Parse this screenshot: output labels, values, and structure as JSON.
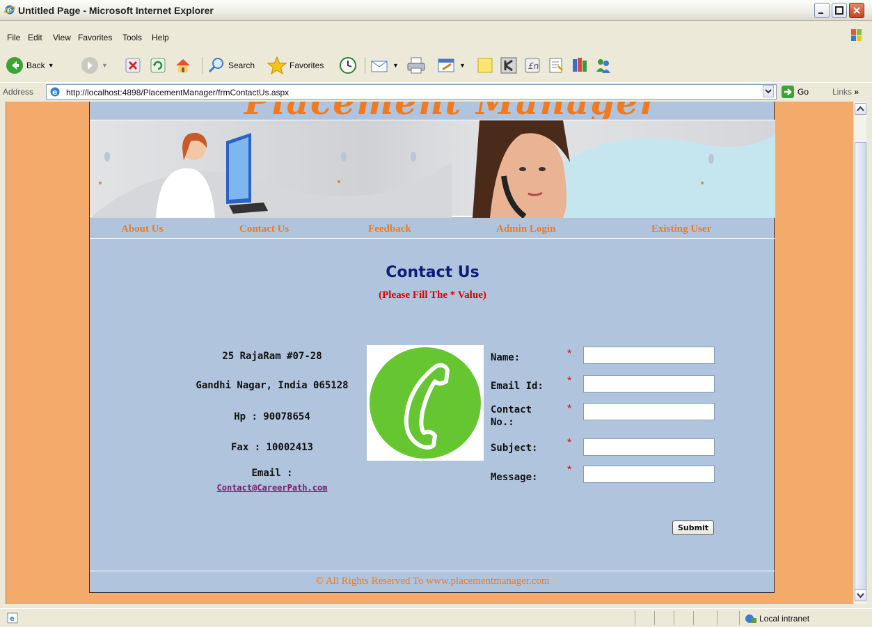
{
  "window": {
    "title": "Untitled Page - Microsoft Internet Explorer"
  },
  "menu": [
    "File",
    "Edit",
    "View",
    "Favorites",
    "Tools",
    "Help"
  ],
  "toolbar": {
    "back_label": "Back",
    "search_label": "Search",
    "favorites_label": "Favorites"
  },
  "address": {
    "label": "Address",
    "url": "http://localhost:4898/PlacementManager/frmContactUs.aspx",
    "go_label": "Go",
    "links_label": "Links"
  },
  "site": {
    "logo_text": "Placement Manager",
    "nav": [
      "About Us",
      "Contact Us",
      "Feedback",
      "Admin Login",
      "Existing User"
    ],
    "heading": "Contact Us",
    "subheading": "(Please Fill The * Value)",
    "address_lines": [
      "25 RajaRam #07-28",
      "Gandhi Nagar, India 065128",
      "Hp : 90078654",
      "Fax : 10002413",
      "Email :"
    ],
    "email": "Contact@CareerPath.com",
    "form": {
      "name_label": "Name:",
      "email_label": "Email Id:",
      "contact_label_1": "Contact",
      "contact_label_2": "No.:",
      "subject_label": "Subject:",
      "message_label": "Message:",
      "required_mark": "*",
      "submit_label": "Submit"
    },
    "footer": "© All Rights Reserved To www.placementmanager.com"
  },
  "status": {
    "zone": "Local intranet"
  },
  "colors": {
    "accent_orange": "#f27a1c",
    "page_blue": "#b0c4dd",
    "heading_navy": "#0c1e7a",
    "required_red": "#e00000",
    "phone_green": "#66c632"
  }
}
